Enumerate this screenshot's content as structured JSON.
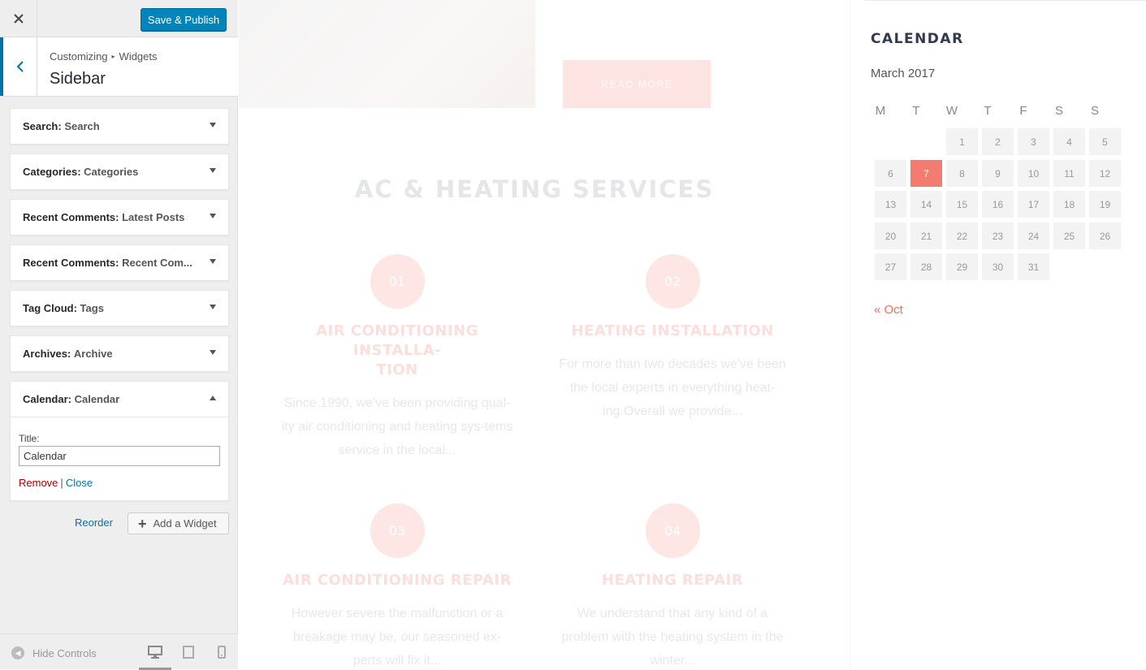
{
  "customizer": {
    "close_icon": "close-icon",
    "save_label": "Save & Publish",
    "breadcrumb": {
      "root": "Customizing",
      "sep": "▸",
      "current": "Widgets"
    },
    "section_title": "Sidebar",
    "widgets": [
      {
        "type": "Search:",
        "title": "Search",
        "open": false
      },
      {
        "type": "Categories:",
        "title": "Categories",
        "open": false
      },
      {
        "type": "Recent Comments:",
        "title": "Latest Posts",
        "open": false
      },
      {
        "type": "Recent Comments:",
        "title": "Recent Com...",
        "open": false
      },
      {
        "type": "Tag Cloud:",
        "title": "Tags",
        "open": false
      },
      {
        "type": "Archives:",
        "title": "Archive",
        "open": false
      },
      {
        "type": "Calendar:",
        "title": "Calendar",
        "open": true
      }
    ],
    "calendar_form": {
      "title_label": "Title:",
      "title_value": "Calendar",
      "remove_label": "Remove",
      "separator": "|",
      "close_label": "Close"
    },
    "reorder_label": "Reorder",
    "add_widget_label": "Add a Widget",
    "hide_controls_label": "Hide Controls",
    "devices": [
      "desktop-icon",
      "tablet-icon",
      "mobile-icon"
    ],
    "accent_color": "#0085ba"
  },
  "preview": {
    "read_more": "READ MORE",
    "services_title": "AC & HEATING SERVICES",
    "services": [
      {
        "num": "01",
        "name": "AIR CONDITIONING INSTALLA-\nTION",
        "desc": "Since 1990, we've been providing qual-ity air conditioning and heating sys-tems service in the local..."
      },
      {
        "num": "02",
        "name": "HEATING INSTALLATION",
        "desc": "For more than two decades we've been the local experts in everything heat-ing.Overall we provide..."
      },
      {
        "num": "03",
        "name": "AIR CONDITIONING REPAIR",
        "desc": "However severe the malfunction or a breakage may be, our seasoned ex-perts will fix it..."
      },
      {
        "num": "04",
        "name": "HEATING REPAIR",
        "desc": "We understand that any kind of a problem with the heating system in the winter..."
      }
    ],
    "calendar": {
      "heading": "CALENDAR",
      "caption": "March 2017",
      "weekdays": [
        "M",
        "T",
        "W",
        "T",
        "F",
        "S",
        "S"
      ],
      "first_weekday_index": 2,
      "days_in_month": 31,
      "today": 7,
      "prev_link": "« Oct",
      "today_color": "#f37b6f"
    }
  }
}
